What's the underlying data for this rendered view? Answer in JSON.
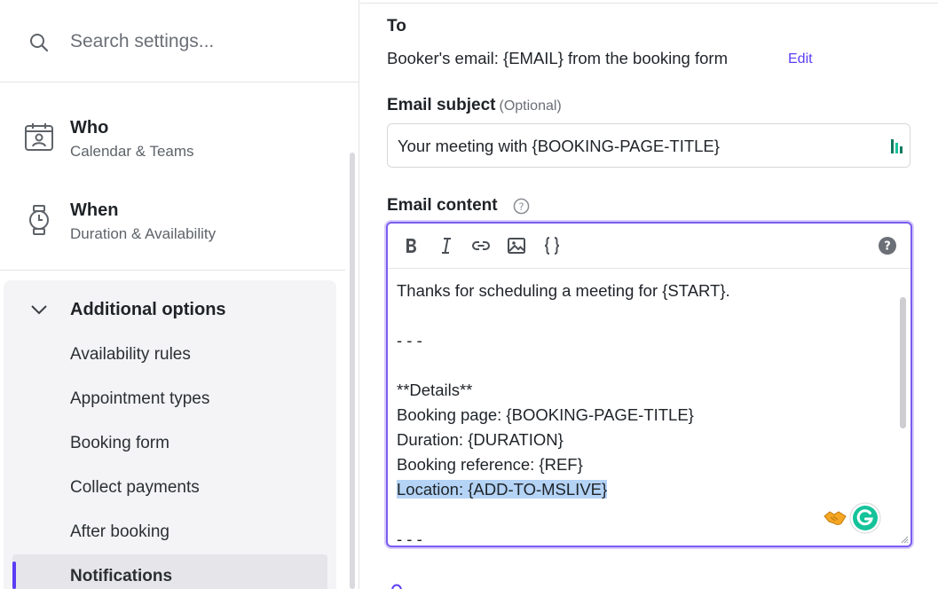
{
  "search": {
    "placeholder": "Search settings..."
  },
  "nav": {
    "who": {
      "title": "Who",
      "subtitle": "Calendar & Teams"
    },
    "when": {
      "title": "When",
      "subtitle": "Duration & Availability"
    }
  },
  "additional": {
    "title": "Additional options",
    "items": [
      {
        "label": "Availability rules"
      },
      {
        "label": "Appointment types"
      },
      {
        "label": "Booking form"
      },
      {
        "label": "Collect payments"
      },
      {
        "label": "After booking"
      },
      {
        "label": "Notifications"
      }
    ],
    "active_index": 5
  },
  "form": {
    "to_label": "To",
    "to_value": "Booker's email: {EMAIL} from the booking form",
    "edit_label": "Edit",
    "subject_label": "Email subject",
    "subject_optional": "(Optional)",
    "subject_value": "Your meeting with {BOOKING-PAGE-TITLE}",
    "content_label": "Email content",
    "content_lines": [
      "Thanks for scheduling a meeting for {START}.",
      "",
      "- - -",
      "",
      "**Details**",
      "Booking page: {BOOKING-PAGE-TITLE}",
      "Duration: {DURATION}",
      "Booking reference: {REF}",
      "Location: {ADD-TO-MSLIVE}",
      "",
      "- - -"
    ]
  },
  "colors": {
    "accent": "#5b3df5",
    "focus_ring": "#7b5cf0",
    "selection": "#b4d3f5",
    "grammarly": "#15c39a"
  },
  "icons": {
    "search": "search-icon",
    "who": "calendar-person-icon",
    "when": "watch-icon",
    "chevron": "chevron-down-icon",
    "bold": "bold-icon",
    "italic": "italic-icon",
    "link": "link-icon",
    "image": "image-icon",
    "code": "braces-icon",
    "help": "help-icon"
  }
}
